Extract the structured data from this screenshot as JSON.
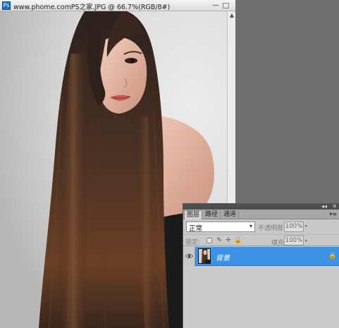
{
  "document": {
    "title": "www.phome.comPS之家.JPG @ 66.7%(RGB/8#)",
    "app_icon_label": "Ps",
    "minimize_glyph": "—",
    "scroll_up_glyph": "▲"
  },
  "layers_panel": {
    "tabs": [
      "图层",
      "路径",
      "通道"
    ],
    "collapse_glyph": "◂◂",
    "close_glyph": "✕",
    "menu_glyph": "▾≡",
    "blend_mode": "正常",
    "blend_arrow": "▾",
    "opacity_label": "不透明度:",
    "opacity_value": "100%",
    "value_arrow": "▸",
    "lock_label": "锁定:",
    "lock_icons": {
      "pixels": "✎",
      "position": "✛",
      "all": "🔒"
    },
    "fill_label": "填充:",
    "fill_value": "100%",
    "layers": [
      {
        "name": "背景",
        "selected": true,
        "visible": true,
        "locked": true
      }
    ]
  },
  "colors": {
    "workspace_bg": "#6e6e6e",
    "selection_blue": "#3d92e6"
  }
}
